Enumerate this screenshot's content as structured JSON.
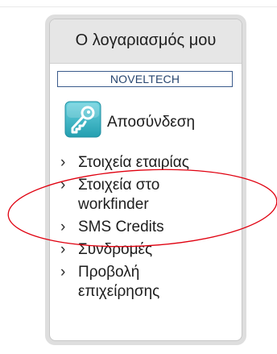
{
  "panel": {
    "title": "Ο λογαριασμός μου",
    "company": "NOVELTECH",
    "logout": {
      "label": "Αποσύνδεση",
      "icon": "key-icon"
    },
    "menu_items": [
      {
        "label_lines": [
          "Στοιχεία εταιρίας"
        ]
      },
      {
        "label_lines": [
          "Στοιχεία στο",
          "workfinder"
        ]
      },
      {
        "label_lines": [
          "SMS Credits"
        ]
      },
      {
        "label_lines": [
          "Συνδρομές"
        ]
      },
      {
        "label_lines": [
          "Προβολή",
          "επιχείρησης"
        ]
      }
    ],
    "chevron_glyph": "›"
  },
  "colors": {
    "panel_border": "#dedede",
    "title_bg": "#e6e6e6",
    "company_border": "#3b5b8c",
    "icon_teal": "#36b4c4",
    "annotation_red": "#e0000f"
  }
}
